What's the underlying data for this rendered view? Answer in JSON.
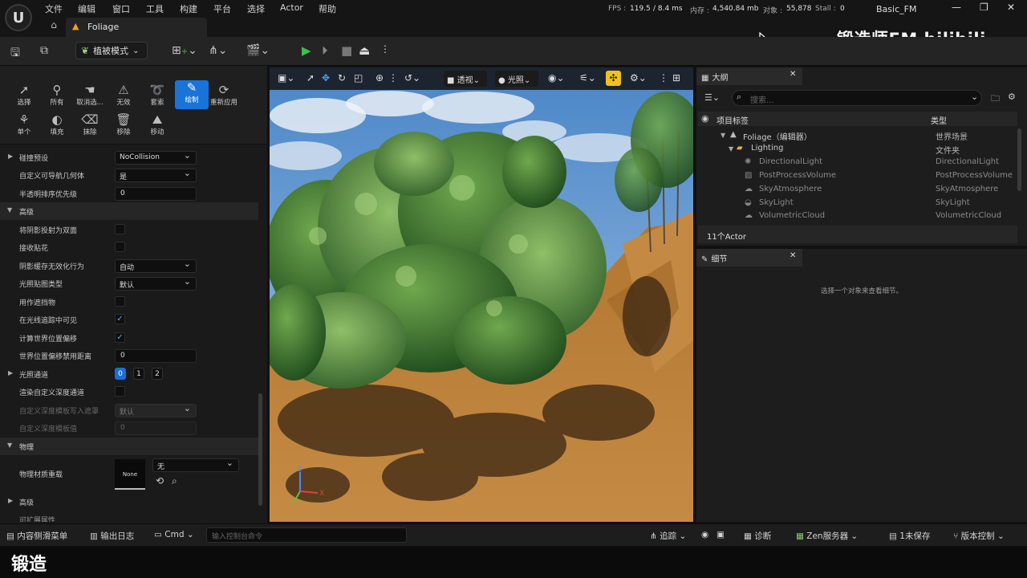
{
  "menu": {
    "items": [
      "文件",
      "编辑",
      "窗口",
      "工具",
      "构建",
      "平台",
      "选择",
      "Actor",
      "帮助"
    ]
  },
  "stats": {
    "fps_label": "FPS :",
    "fps_value": "119.5",
    "ms_value": "/ 8.4 ms",
    "mem_label": "内存 :",
    "mem_value": "4,540.84 mb",
    "obj_label": "对象 :",
    "obj_value": "55,878",
    "stall_label": "Stall :",
    "stall_value": "0"
  },
  "project_name": "Basic_FM",
  "level_tab": "Foliage",
  "toolbar": {
    "mode_label": "植被模式"
  },
  "foliage_tools": [
    {
      "label": "选择",
      "icon": "select-arrow-icon"
    },
    {
      "label": "所有",
      "icon": "select-all-icon"
    },
    {
      "label": "取消选...",
      "icon": "deselect-icon"
    },
    {
      "label": "无效",
      "icon": "invalid-icon"
    },
    {
      "label": "套索",
      "icon": "lasso-icon"
    },
    {
      "label": "绘制",
      "icon": "paint-brush-icon"
    },
    {
      "label": "重新应用",
      "icon": "reapply-icon"
    },
    {
      "label": "单个",
      "icon": "single-icon"
    },
    {
      "label": "填充",
      "icon": "fill-icon"
    },
    {
      "label": "抹除",
      "icon": "erase-icon"
    },
    {
      "label": "移除",
      "icon": "remove-icon"
    },
    {
      "label": "移动",
      "icon": "move-icon"
    }
  ],
  "properties": {
    "collision_preset": {
      "label": "碰撞预设",
      "value": "NoCollision"
    },
    "custom_nav": {
      "label": "自定义可导航几何体",
      "value": "是"
    },
    "translucency_sort": {
      "label": "半透明排序优先级",
      "value": "0"
    },
    "advanced_header": "高级",
    "cast_two_sided": {
      "label": "将阴影投射为双面"
    },
    "receive_decals": {
      "label": "接收贴花"
    },
    "shadow_cache": {
      "label": "阴影缓存无效化行为",
      "value": "自动"
    },
    "lightmap_type": {
      "label": "光照贴图类型",
      "value": "默认"
    },
    "use_as_occluder": {
      "label": "用作遮挡物"
    },
    "visible_in_raytracing": {
      "label": "在光线追踪中可见"
    },
    "eval_wpo": {
      "label": "计算世界位置偏移"
    },
    "wpo_disable_distance": {
      "label": "世界位置偏移禁用距离",
      "value": "0"
    },
    "lighting_channels": {
      "label": "光照通道",
      "channels": [
        "0",
        "1",
        "2"
      ]
    },
    "render_custom_depth": {
      "label": "渲染自定义深度通道"
    },
    "custom_depth_mask": {
      "label": "自定义深度模板写入遮罩",
      "value": "默认"
    },
    "custom_depth_value": {
      "label": "自定义深度模板值",
      "value": "0"
    },
    "physics_header": "物理",
    "phys_material": {
      "label": "物理材质重载",
      "value": "无",
      "thumb": "None"
    },
    "advanced2_header": "高级",
    "cut_off": "可扩展属性"
  },
  "viewport": {
    "perspective": "透视",
    "lit": "光照",
    "axis_x": "X",
    "axis_z": "Z"
  },
  "outliner": {
    "tab": "大纲",
    "search_placeholder": "搜索...",
    "col_label": "项目标签",
    "col_type": "类型",
    "rows": [
      {
        "name": "Foliage（编辑器）",
        "type": "世界场景"
      },
      {
        "name": "Lighting",
        "type": "文件夹"
      },
      {
        "name": "DirectionalLight",
        "type": "DirectionalLight"
      },
      {
        "name": "PostProcessVolume",
        "type": "PostProcessVolume"
      },
      {
        "name": "SkyAtmosphere",
        "type": "SkyAtmosphere"
      },
      {
        "name": "SkyLight",
        "type": "SkyLight"
      },
      {
        "name": "VolumetricCloud",
        "type": "VolumetricCloud"
      }
    ],
    "count": "11个Actor"
  },
  "details": {
    "tab": "细节",
    "empty_msg": "选择一个对象来查看细节。"
  },
  "statusbar": {
    "content_drawer": "内容侧滑菜单",
    "output_log": "输出日志",
    "cmd": "Cmd",
    "cmd_placeholder": "输入控制台命令",
    "trace": "追踪",
    "diagnose": "诊断",
    "zen": "Zen服务器",
    "unsaved": "1未保存",
    "source_control": "版本控制"
  },
  "watermark": "锻造师FM bilibili",
  "caption": "锻造",
  "colors": {
    "accent": "#1973d8",
    "play_green": "#3cc24a",
    "folder": "#e8b04a"
  }
}
